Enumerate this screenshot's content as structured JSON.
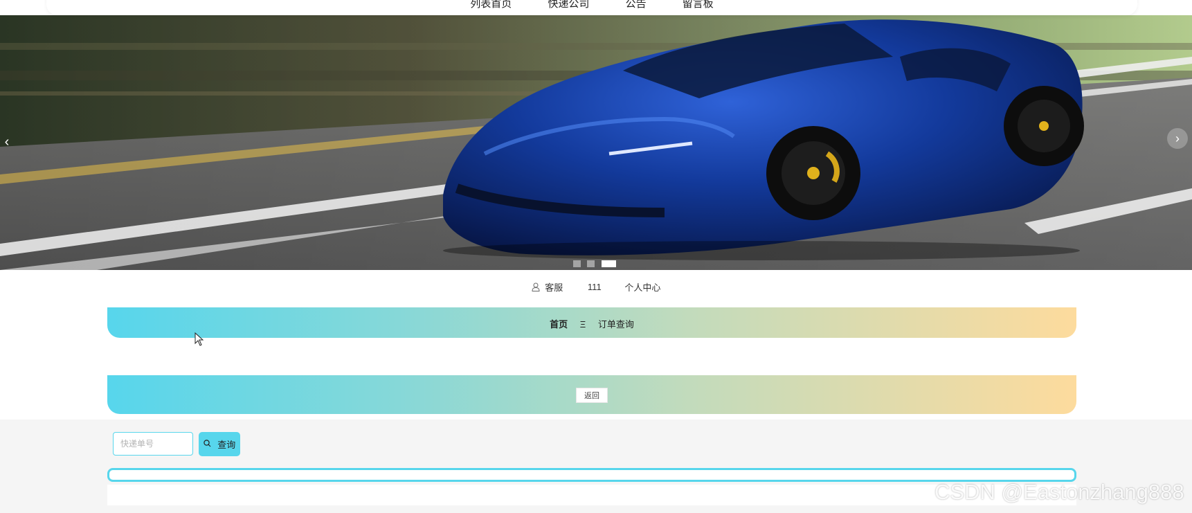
{
  "topnav": {
    "items": [
      "列表首页",
      "快递公司",
      "公告",
      "留言板"
    ]
  },
  "carousel": {
    "slide_count": 3,
    "active_index": 2,
    "prev_icon": "chevron-left-icon",
    "next_icon": "chevron-right-icon"
  },
  "user_bar": {
    "icon": "user-icon",
    "label": "客服",
    "user_id": "111",
    "center_link": "个人中心"
  },
  "breadcrumb": {
    "home": "首页",
    "separator": "Ξ",
    "current": "订单查询"
  },
  "back": {
    "label": "返回"
  },
  "search": {
    "placeholder": "快递单号",
    "value": "",
    "button_label": "查询",
    "button_icon": "search-icon"
  },
  "colors": {
    "accent": "#57d6ec",
    "gradient_start": "#57d6ec",
    "gradient_end": "#fddb9d",
    "content_bg": "#f5f5f5"
  },
  "watermark": "CSDN @Eastonzhang888"
}
